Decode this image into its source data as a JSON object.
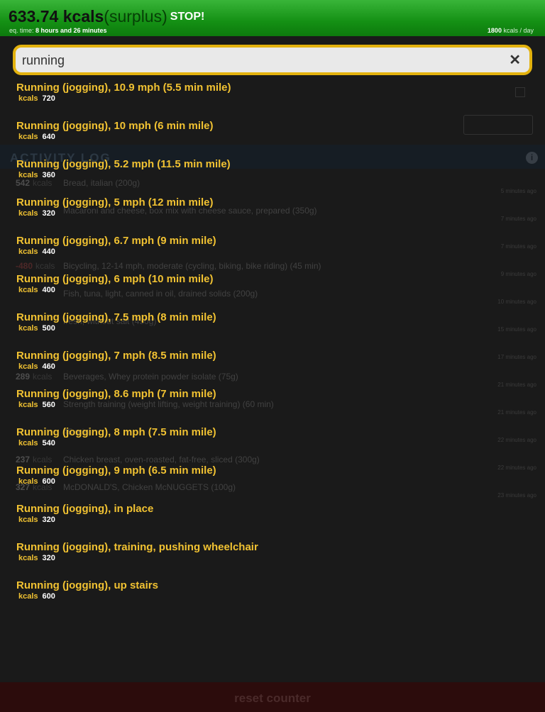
{
  "header": {
    "kcal_value": "633.74 kcals",
    "surplus_label": "(surplus)",
    "stop_label": "STOP!",
    "eq_time_label": "eq. time:",
    "eq_time_value": "8 hours and 26 minutes",
    "rate_value": "1800",
    "rate_unit": "kcals / day"
  },
  "search": {
    "value": "running",
    "clear_icon": "close-icon"
  },
  "background": {
    "activity_title": "ACTIVITY LOG",
    "entries": [
      {
        "kcal": "542",
        "unit": "kcals",
        "desc": "Bread, italian (200g)",
        "time": "5 minutes ago"
      },
      {
        "kcal": "",
        "unit": "",
        "desc": "Macaroni and cheese, box mix with cheese sauce, prepared (350g)",
        "time": "7 minutes ago"
      },
      {
        "kcal": "",
        "unit": "",
        "desc": "",
        "time": "7 minutes ago"
      },
      {
        "kcal": "-480",
        "unit": "kcals",
        "desc": "Bicycling, 12-14 mph, moderate (cycling, biking, bike riding) (45 min)",
        "time": "9 minutes ago"
      },
      {
        "kcal": "",
        "unit": "",
        "desc": "Fish, tuna, light, canned in oil, drained solids (200g)",
        "time": "10 minutes ago"
      },
      {
        "kcal": "",
        "unit": "",
        "desc": "fresh, without salt (450g)",
        "time": "15 minutes ago"
      },
      {
        "kcal": "",
        "unit": "",
        "desc": "",
        "time": "17 minutes ago"
      },
      {
        "kcal": "289",
        "unit": "kcals",
        "desc": "Beverages, Whey protein powder isolate (75g)",
        "time": "21 minutes ago"
      },
      {
        "kcal": "",
        "unit": "",
        "desc": "Strength training (weight lifting, weight training) (60 min)",
        "time": "21 minutes ago"
      },
      {
        "kcal": "",
        "unit": "",
        "desc": "45 min)",
        "time": "22 minutes ago"
      },
      {
        "kcal": "237",
        "unit": "kcals",
        "desc": "Chicken breast, oven-roasted, fat-free, sliced (300g)",
        "time": "22 minutes ago"
      },
      {
        "kcal": "327",
        "unit": "kcals",
        "desc": "McDONALD'S, Chicken McNUGGETS (100g)",
        "time": "23 minutes ago"
      }
    ]
  },
  "suggestions": [
    {
      "name": "Running (jogging), 10.9 mph (5.5 min mile)",
      "kcal_label": "kcals",
      "kcal": "720"
    },
    {
      "name": "Running (jogging), 10 mph (6 min mile)",
      "kcal_label": "kcals",
      "kcal": "640"
    },
    {
      "name": "Running (jogging), 5.2 mph (11.5 min mile)",
      "kcal_label": "kcals",
      "kcal": "360"
    },
    {
      "name": "Running (jogging), 5 mph (12 min mile)",
      "kcal_label": "kcals",
      "kcal": "320"
    },
    {
      "name": "Running (jogging), 6.7 mph (9 min mile)",
      "kcal_label": "kcals",
      "kcal": "440"
    },
    {
      "name": "Running (jogging), 6 mph (10 min mile)",
      "kcal_label": "kcals",
      "kcal": "400"
    },
    {
      "name": "Running (jogging), 7.5 mph (8 min mile)",
      "kcal_label": "kcals",
      "kcal": "500"
    },
    {
      "name": "Running (jogging), 7 mph (8.5 min mile)",
      "kcal_label": "kcals",
      "kcal": "460"
    },
    {
      "name": "Running (jogging), 8.6 mph (7 min mile)",
      "kcal_label": "kcals",
      "kcal": "560"
    },
    {
      "name": "Running (jogging), 8 mph (7.5 min mile)",
      "kcal_label": "kcals",
      "kcal": "540"
    },
    {
      "name": "Running (jogging), 9 mph (6.5 min mile)",
      "kcal_label": "kcals",
      "kcal": "600"
    },
    {
      "name": "Running (jogging), in place",
      "kcal_label": "kcals",
      "kcal": "320"
    },
    {
      "name": "Running (jogging), training, pushing wheelchair",
      "kcal_label": "kcals",
      "kcal": "320"
    },
    {
      "name": "Running (jogging), up stairs",
      "kcal_label": "kcals",
      "kcal": "600"
    }
  ],
  "footer": {
    "reset_label": "reset counter"
  },
  "colors": {
    "header_green": "#149014",
    "search_border": "#e3b20e",
    "suggestion_text": "#f1c232"
  }
}
